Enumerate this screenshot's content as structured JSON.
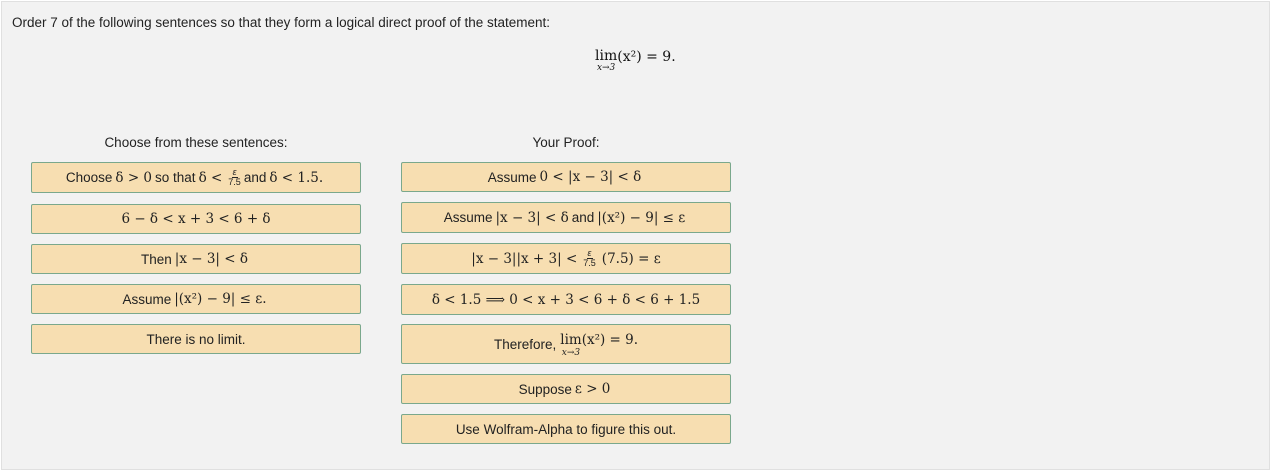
{
  "prompt": "Order 7 of the following sentences so that they form a logical direct proof of the statement:",
  "statement": {
    "lim_word": "lim",
    "lim_sub": "x→3",
    "expr": "(x²) = 9."
  },
  "left_header": "Choose from these sentences:",
  "right_header": "Your Proof:",
  "left_cards": {
    "c1": {
      "t1": "Choose",
      "m1": "δ > 0",
      "t2": "so that",
      "m2": "δ <",
      "frac_num": "ε",
      "frac_den": "7.5",
      "t3": "and",
      "m3": "δ < 1.5."
    },
    "c2": {
      "m1": "6 − δ < x + 3 < 6 + δ"
    },
    "c3": {
      "t1": "Then",
      "m1": "|x − 3| < δ"
    },
    "c4": {
      "t1": "Assume",
      "m1": "|(x²) − 9| ≤ ε."
    },
    "c5": {
      "t1": "There is no limit."
    }
  },
  "right_cards": {
    "r1": {
      "t1": "Assume",
      "m1": "0 < |x − 3| < δ"
    },
    "r2": {
      "t1": "Assume",
      "m1": "|x − 3| < δ",
      "t2": "and",
      "m2": "|(x²) − 9| ≤ ε"
    },
    "r3": {
      "m1": "|x − 3||x + 3| <",
      "frac_num": "ε",
      "frac_den": "7.5",
      "m2": "(7.5) = ε"
    },
    "r4": {
      "m1": "δ < 1.5  ⟹  0 < x + 3 < 6 + δ < 6 + 1.5"
    },
    "r5": {
      "t1": "Therefore,",
      "lim_word": "lim",
      "lim_sub": "x→3",
      "m1": "(x²) = 9."
    },
    "r6": {
      "t1": "Suppose",
      "m1": "ε > 0"
    },
    "r7": {
      "t1": "Use Wolfram-Alpha to figure this out."
    }
  }
}
